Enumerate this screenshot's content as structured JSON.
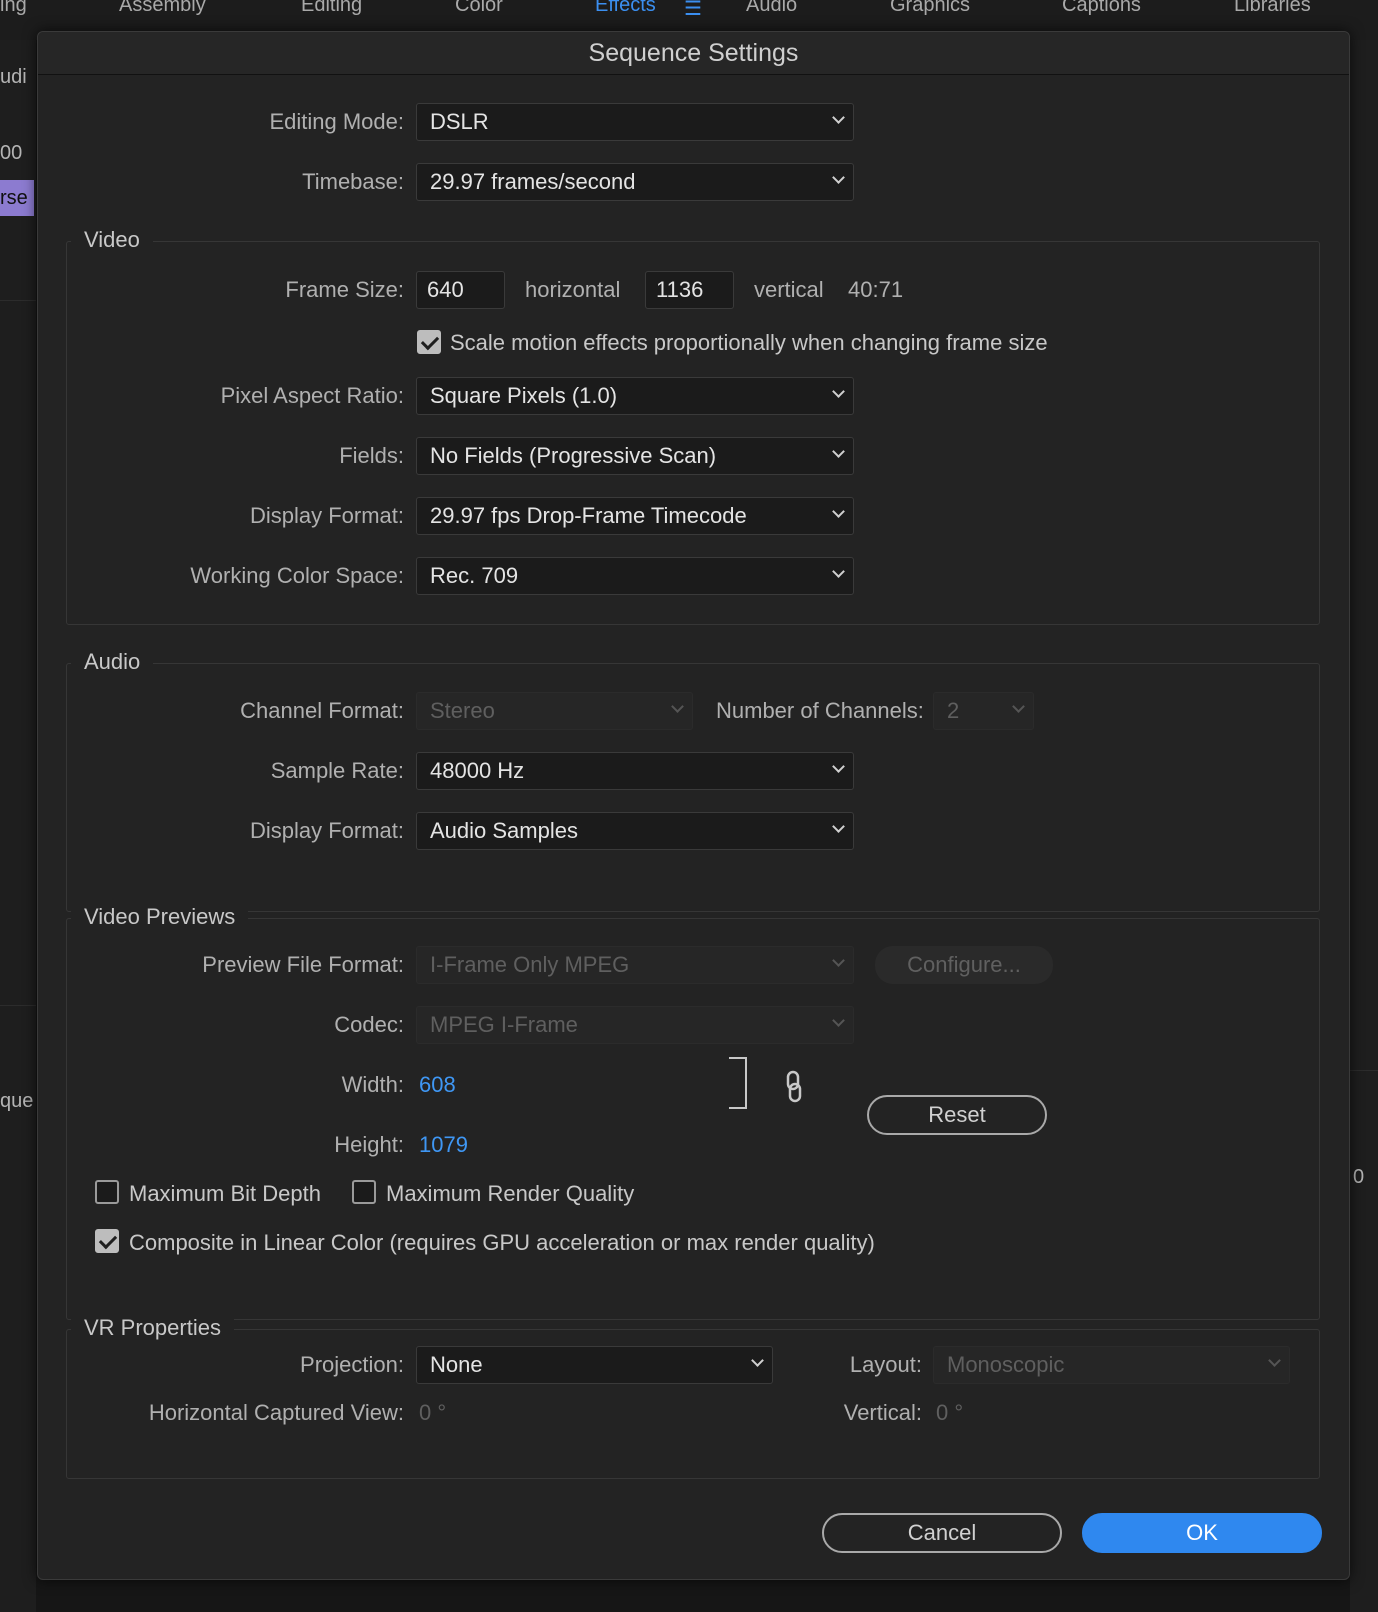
{
  "workspace_tabs": [
    {
      "label": "ing"
    },
    {
      "label": "Assembly"
    },
    {
      "label": "Editing"
    },
    {
      "label": "Color"
    },
    {
      "label": "Effects"
    },
    {
      "label": "Audio"
    },
    {
      "label": "Graphics"
    },
    {
      "label": "Captions"
    },
    {
      "label": "Libraries"
    }
  ],
  "background": {
    "left_text_1": "udi",
    "left_text_2": "00",
    "left_clip": "rse",
    "left_text_3": "que",
    "right_text": "0"
  },
  "dialog": {
    "title": "Sequence Settings",
    "editing_mode": {
      "label": "Editing Mode:",
      "value": "DSLR"
    },
    "timebase": {
      "label": "Timebase:",
      "value": "29.97  frames/second"
    },
    "video": {
      "title": "Video",
      "frame_size": {
        "label": "Frame Size:",
        "width": "640",
        "horizontal": "horizontal",
        "height": "1136",
        "vertical": "vertical",
        "ratio": "40:71"
      },
      "scale_motion": {
        "label": "Scale motion effects proportionally when changing frame size",
        "checked": true
      },
      "pixel_aspect": {
        "label": "Pixel Aspect Ratio:",
        "value": "Square Pixels (1.0)"
      },
      "fields": {
        "label": "Fields:",
        "value": "No Fields (Progressive Scan)"
      },
      "display_format": {
        "label": "Display Format:",
        "value": "29.97 fps Drop-Frame Timecode"
      },
      "color_space": {
        "label": "Working Color Space:",
        "value": "Rec. 709"
      }
    },
    "audio": {
      "title": "Audio",
      "channel_format": {
        "label": "Channel Format:",
        "value": "Stereo"
      },
      "num_channels": {
        "label": "Number of Channels:",
        "value": "2"
      },
      "sample_rate": {
        "label": "Sample Rate:",
        "value": "48000 Hz"
      },
      "display_format": {
        "label": "Display Format:",
        "value": "Audio Samples"
      }
    },
    "previews": {
      "title": "Video Previews",
      "file_format": {
        "label": "Preview File Format:",
        "value": "I-Frame Only MPEG"
      },
      "configure": "Configure...",
      "codec": {
        "label": "Codec:",
        "value": "MPEG I-Frame"
      },
      "width": {
        "label": "Width:",
        "value": "608"
      },
      "height": {
        "label": "Height:",
        "value": "1079"
      },
      "reset": "Reset",
      "max_bit_depth": {
        "label": "Maximum Bit Depth",
        "checked": false
      },
      "max_render_quality": {
        "label": "Maximum Render Quality",
        "checked": false
      },
      "linear_color": {
        "label": "Composite in Linear Color (requires GPU acceleration or max render quality)",
        "checked": true
      }
    },
    "vr": {
      "title": "VR Properties",
      "projection": {
        "label": "Projection:",
        "value": "None"
      },
      "layout": {
        "label": "Layout:",
        "value": "Monoscopic"
      },
      "horizontal_view": {
        "label": "Horizontal Captured View:",
        "value": "0 °"
      },
      "vertical": {
        "label": "Vertical:",
        "value": "0 °"
      }
    },
    "cancel": "Cancel",
    "ok": "OK"
  },
  "colors": {
    "accent": "#2f88ef",
    "link_value": "#3f97f4",
    "dialog_bg": "#232323"
  },
  "icons": {
    "workspace_menu": "hamburger-menu-icon",
    "link": "chain-link-icon",
    "dropdown": "chevron-down-icon"
  }
}
